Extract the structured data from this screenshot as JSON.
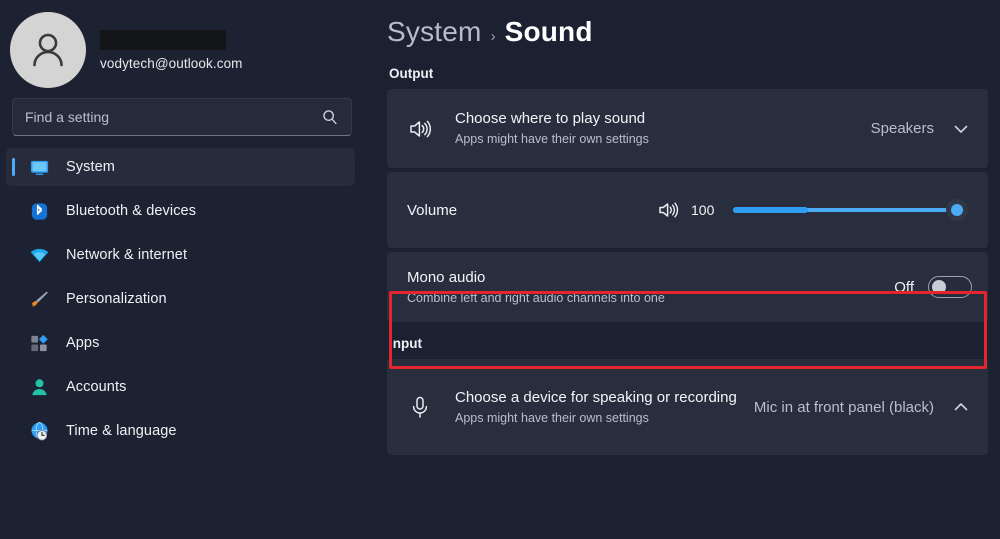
{
  "account": {
    "email": "vodytech@outlook.com",
    "name_redacted": true,
    "avatar_icon": "person-avatar-icon"
  },
  "search": {
    "placeholder": "Find a setting",
    "value": "",
    "icon": "search-icon"
  },
  "sidebar": {
    "items": [
      {
        "label": "System",
        "icon": "monitor-icon",
        "selected": true
      },
      {
        "label": "Bluetooth & devices",
        "icon": "bluetooth-icon",
        "selected": false
      },
      {
        "label": "Network & internet",
        "icon": "wifi-icon",
        "selected": false
      },
      {
        "label": "Personalization",
        "icon": "paintbrush-icon",
        "selected": false
      },
      {
        "label": "Apps",
        "icon": "apps-icon",
        "selected": false
      },
      {
        "label": "Accounts",
        "icon": "person-icon",
        "selected": false
      },
      {
        "label": "Time & language",
        "icon": "clock-globe-icon",
        "selected": false
      }
    ]
  },
  "breadcrumb": {
    "parent": "System",
    "separator": "›",
    "current": "Sound"
  },
  "sections": {
    "output": {
      "label": "Output",
      "play_device": {
        "title": "Choose where to play sound",
        "subtitle": "Apps might have their own settings",
        "value": "Speakers",
        "icon": "speaker-icon",
        "chevron": "chevron-down-icon"
      },
      "volume": {
        "label": "Volume",
        "value": "100",
        "percent": 100,
        "icon": "speaker-icon"
      },
      "mono_audio": {
        "title": "Mono audio",
        "subtitle": "Combine left and right audio channels into one",
        "state": "Off",
        "toggle_on": false,
        "highlighted": true
      }
    },
    "input": {
      "label": "Input",
      "record_device": {
        "title": "Choose a device for speaking or recording",
        "subtitle": "Apps might have their own settings",
        "value": "Mic in at front panel (black)",
        "icon": "microphone-icon",
        "chevron": "chevron-up-icon"
      }
    }
  },
  "colors": {
    "accent_blue": "#4cabf5",
    "highlight_red": "#e5252c",
    "page_background": "#1b2130",
    "card_background": "#282e3e"
  }
}
